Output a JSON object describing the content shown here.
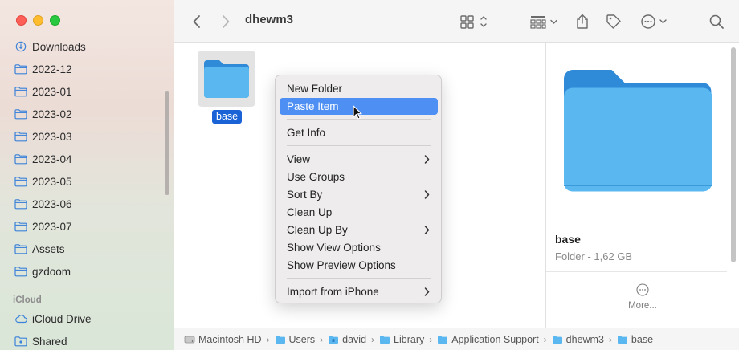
{
  "window": {
    "title": "dhewm3"
  },
  "sidebar": {
    "items": [
      {
        "label": "Downloads",
        "icon": "download-icon"
      },
      {
        "label": "2022-12",
        "icon": "folder-icon"
      },
      {
        "label": "2023-01",
        "icon": "folder-icon"
      },
      {
        "label": "2023-02",
        "icon": "folder-icon"
      },
      {
        "label": "2023-03",
        "icon": "folder-icon"
      },
      {
        "label": "2023-04",
        "icon": "folder-icon"
      },
      {
        "label": "2023-05",
        "icon": "folder-icon"
      },
      {
        "label": "2023-06",
        "icon": "folder-icon"
      },
      {
        "label": "2023-07",
        "icon": "folder-icon"
      },
      {
        "label": "Assets",
        "icon": "folder-icon"
      },
      {
        "label": "gzdoom",
        "icon": "folder-icon"
      }
    ],
    "icloud_section": "iCloud",
    "icloud_items": [
      {
        "label": "iCloud Drive",
        "icon": "cloud-icon"
      },
      {
        "label": "Shared",
        "icon": "shared-folder-icon"
      }
    ]
  },
  "content": {
    "selected_item": {
      "name": "base",
      "icon": "folder-icon"
    }
  },
  "context_menu": {
    "items": [
      {
        "label": "New Folder"
      },
      {
        "label": "Paste Item",
        "highlighted": true
      },
      {
        "label": "Get Info"
      },
      {
        "label": "View",
        "submenu": true
      },
      {
        "label": "Use Groups"
      },
      {
        "label": "Sort By",
        "submenu": true
      },
      {
        "label": "Clean Up"
      },
      {
        "label": "Clean Up By",
        "submenu": true
      },
      {
        "label": "Show View Options"
      },
      {
        "label": "Show Preview Options"
      },
      {
        "label": "Import from iPhone",
        "submenu": true
      }
    ]
  },
  "preview": {
    "name": "base",
    "meta": "Folder - 1,62 GB",
    "more_label": "More..."
  },
  "pathbar": {
    "crumbs": [
      "Macintosh HD",
      "Users",
      "david",
      "Library",
      "Application Support",
      "dhewm3",
      "base"
    ]
  },
  "colors": {
    "accent": "#1a63d6",
    "menu_highlight": "#4e8ff3",
    "folder_blue": "#4fb0ec"
  }
}
